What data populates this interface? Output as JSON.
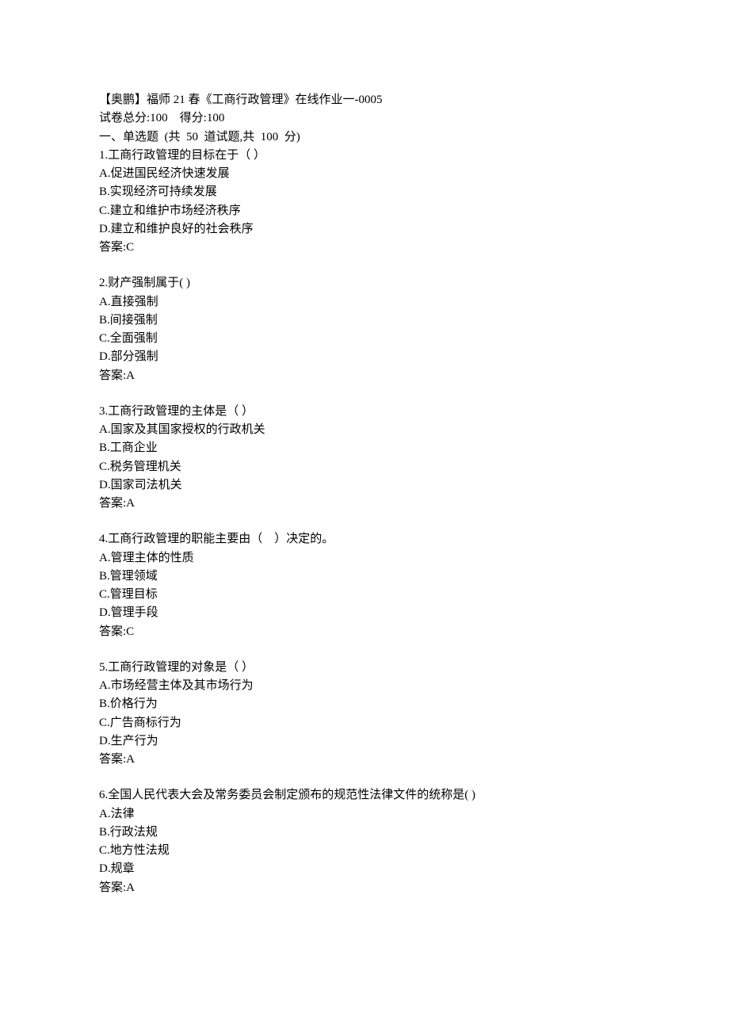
{
  "header": {
    "title": "【奥鹏】福师 21 春《工商行政管理》在线作业一-0005",
    "score_line": "试卷总分:100 得分:100",
    "section": "一、单选题  (共  50  道试题,共  100  分)"
  },
  "answer_prefix": "答案:",
  "questions": [
    {
      "stem": "1.工商行政管理的目标在于（ ）",
      "options": [
        "A.促进国民经济快速发展",
        "B.实现经济可持续发展",
        "C.建立和维护市场经济秩序",
        "D.建立和维护良好的社会秩序"
      ],
      "answer": "C"
    },
    {
      "stem": "2.财产强制属于( )",
      "options": [
        "A.直接强制",
        "B.间接强制",
        "C.全面强制",
        "D.部分强制"
      ],
      "answer": "A"
    },
    {
      "stem": "3.工商行政管理的主体是（ ）",
      "options": [
        "A.国家及其国家授权的行政机关",
        "B.工商企业",
        "C.税务管理机关",
        "D.国家司法机关"
      ],
      "answer": "A"
    },
    {
      "stem": "4.工商行政管理的职能主要由（ ）决定的。",
      "options": [
        "A.管理主体的性质",
        "B.管理领域",
        "C.管理目标",
        "D.管理手段"
      ],
      "answer": "C"
    },
    {
      "stem": "5.工商行政管理的对象是（ ）",
      "options": [
        "A.市场经营主体及其市场行为",
        "B.价格行为",
        "C.广告商标行为",
        "D.生产行为"
      ],
      "answer": "A"
    },
    {
      "stem": "6.全国人民代表大会及常务委员会制定颁布的规范性法律文件的统称是( )",
      "options": [
        "A.法律",
        "B.行政法规",
        "C.地方性法规",
        "D.规章"
      ],
      "answer": "A"
    }
  ]
}
